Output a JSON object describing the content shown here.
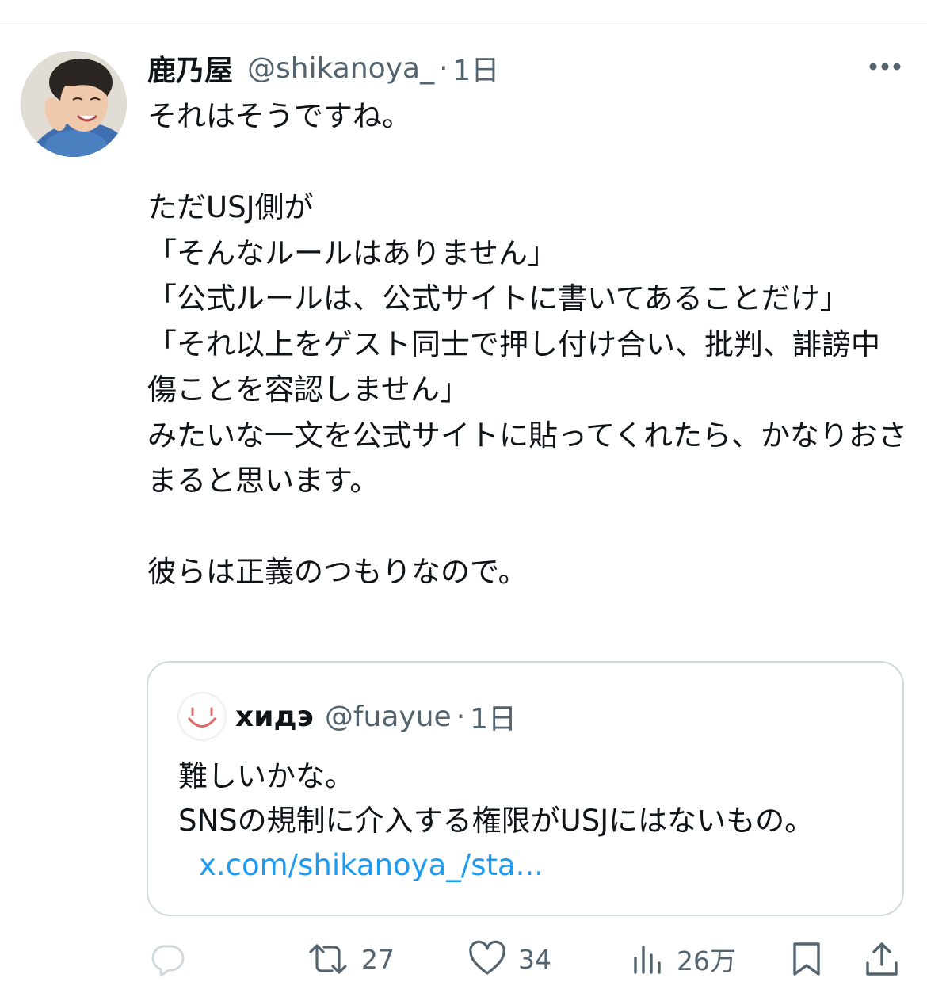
{
  "tweet": {
    "display_name": "鹿乃屋",
    "handle": "@shikanoya_",
    "separator": "·",
    "time": "1日",
    "text": "それはそうですね。\n\nただUSJ側が\n「そんなルールはありません」\n「公式ルールは、公式サイトに書いてあることだけ」\n「それ以上をゲスト同士で押し付け合い、批判、誹謗中傷ことを容認しません」\nみたいな一文を公式サイトに貼ってくれたら、かなりおさまると思います。\n\n彼らは正義のつもりなので。"
  },
  "quote": {
    "display_name": "хидэ",
    "handle": "@fuayue",
    "separator": "·",
    "time": "1日",
    "text": "難しいかな。\nSNSの規制に介入する権限がUSJにはないもの。",
    "link": "x.com/shikanoya_/sta..."
  },
  "actions": {
    "reply_count": "",
    "retweet_count": "27",
    "like_count": "34",
    "views_count": "26万"
  },
  "icons": {
    "more": "more-dots-icon",
    "reply": "reply-icon",
    "retweet": "retweet-icon",
    "like": "heart-icon",
    "views": "views-icon",
    "bookmark": "bookmark-icon",
    "share": "share-icon"
  },
  "colors": {
    "text": "#0f1419",
    "secondary": "#536471",
    "link": "#1d9bf0",
    "border": "#cfd9de"
  }
}
